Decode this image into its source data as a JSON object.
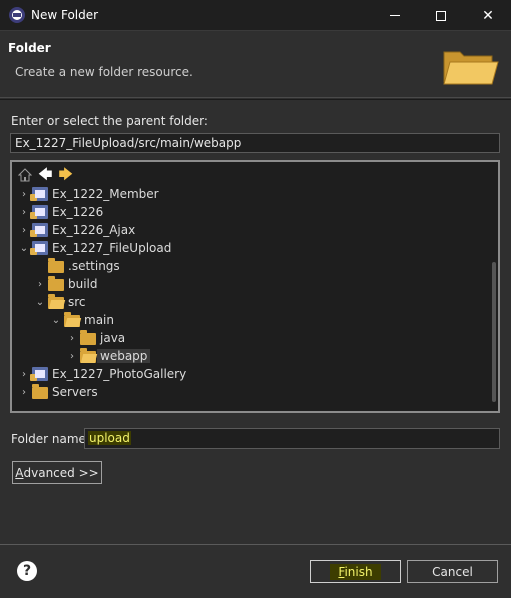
{
  "window": {
    "title": "New Folder",
    "minimize_icon": "minimize-icon",
    "maximize_icon": "maximize-icon",
    "close_glyph": "✕"
  },
  "header": {
    "title": "Folder",
    "description": "Create a new folder resource.",
    "icon": "open-folder-icon"
  },
  "parent": {
    "label": "Enter or select the parent folder:",
    "value": "Ex_1227_FileUpload/src/main/webapp"
  },
  "tree": {
    "toolbar": {
      "home_icon": "home-icon",
      "back_icon": "back-arrow-icon",
      "forward_icon": "forward-arrow-icon"
    },
    "items": [
      {
        "label": "Ex_1222_Member",
        "depth": 0,
        "expanded": false,
        "type": "project"
      },
      {
        "label": "Ex_1226",
        "depth": 0,
        "expanded": false,
        "type": "project"
      },
      {
        "label": "Ex_1226_Ajax",
        "depth": 0,
        "expanded": false,
        "type": "project"
      },
      {
        "label": "Ex_1227_FileUpload",
        "depth": 0,
        "expanded": true,
        "type": "project"
      },
      {
        "label": ".settings",
        "depth": 1,
        "expanded": null,
        "type": "folder"
      },
      {
        "label": "build",
        "depth": 1,
        "expanded": false,
        "type": "folder"
      },
      {
        "label": "src",
        "depth": 1,
        "expanded": true,
        "type": "folder"
      },
      {
        "label": "main",
        "depth": 2,
        "expanded": true,
        "type": "folder"
      },
      {
        "label": "java",
        "depth": 3,
        "expanded": false,
        "type": "folder"
      },
      {
        "label": "webapp",
        "depth": 3,
        "expanded": false,
        "type": "folder",
        "selected": true
      },
      {
        "label": "Ex_1227_PhotoGallery",
        "depth": 0,
        "expanded": false,
        "type": "project"
      },
      {
        "label": "Servers",
        "depth": 0,
        "expanded": false,
        "type": "folder"
      }
    ]
  },
  "folder_name": {
    "label": "Folder name:",
    "value": "upload"
  },
  "buttons": {
    "advanced_prefix": "A",
    "advanced_rest": "dvanced >>",
    "finish_prefix": "F",
    "finish_rest": "inish",
    "cancel": "Cancel",
    "help_glyph": "?"
  },
  "colors": {
    "background": "#2f2f2f",
    "titlebar": "#1f1f1f",
    "highlight": "#f3f36a",
    "folder": "#d9a53a"
  }
}
